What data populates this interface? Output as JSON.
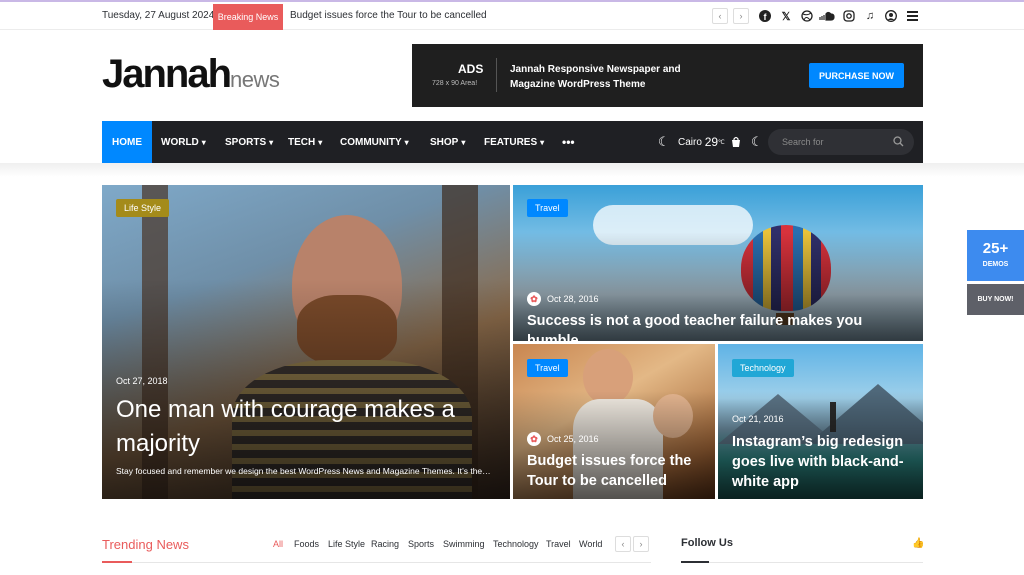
{
  "topbar": {
    "date": "Tuesday, 27 August 2024",
    "breaking_label": "Breaking News",
    "breaking_headline": "Budget issues force the Tour to be cancelled",
    "prev_icon": "chevron-left-icon",
    "next_icon": "chevron-right-icon",
    "social_icons": [
      "facebook-icon",
      "x-icon",
      "dribbble-icon",
      "soundcloud-icon",
      "instagram-icon",
      "tiktok-icon",
      "user-icon",
      "menu-icon"
    ]
  },
  "logo": {
    "main": "Jannah",
    "sub": "news"
  },
  "ad": {
    "title": "ADS",
    "size": "728 x 90 Area!",
    "description": "Jannah Responsive Newspaper and Magazine WordPress Theme",
    "button": "PURCHASE NOW"
  },
  "nav": {
    "home": "HOME",
    "items": [
      "WORLD",
      "SPORTS",
      "TECH",
      "COMMUNITY",
      "SHOP",
      "FEATURES"
    ],
    "more": "•••",
    "weather_city": "Cairo",
    "weather_temp": "29",
    "weather_unit": "℃",
    "search_placeholder": "Search for"
  },
  "featured": [
    {
      "tag": "Life Style",
      "date": "Oct 27, 2018",
      "title": "One man with courage makes a majority",
      "excerpt": "Stay focused and remember we design the best WordPress News and Magazine Themes. It’s the…"
    },
    {
      "tag": "Travel",
      "date": "Oct 28, 2016",
      "title": "Success is not a good teacher failure makes you humble"
    },
    {
      "tag": "Travel",
      "date": "Oct 25, 2016",
      "title": "Budget issues force the Tour to be cancelled"
    },
    {
      "tag": "Technology",
      "date": "Oct 21, 2016",
      "title": "Instagram’s big redesign goes live with black-and-white app"
    }
  ],
  "side": {
    "demos_count": "25+",
    "demos_label": "DEMOS",
    "buy": "BUY NOW!"
  },
  "trending": {
    "title": "Trending News",
    "filters": [
      "All",
      "Foods",
      "Life Style",
      "Racing",
      "Sports",
      "Swimming",
      "Technology",
      "Travel",
      "World"
    ]
  },
  "follow": {
    "title": "Follow Us"
  },
  "colors": {
    "accent": "#0088ff",
    "breaking": "#e95b5b",
    "nav_bg": "#1f2024"
  }
}
